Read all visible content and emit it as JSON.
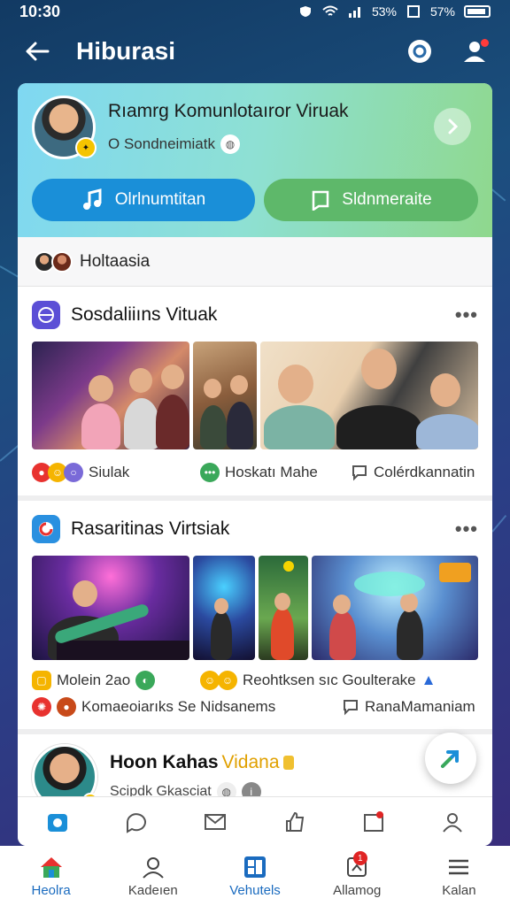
{
  "status_bar": {
    "time": "10:30",
    "battery_text_1": "5̈3%",
    "battery_text_2": "5̈7%"
  },
  "app_bar": {
    "title": "Hiburasi"
  },
  "header": {
    "name": "Rıamrg Komunlotaıror Viruak",
    "subtitle": "O Sondneimiatk",
    "button_left": "Olrlnumtitan",
    "button_right": "Sldnmeraite"
  },
  "section": {
    "label": "Holtaasia"
  },
  "post1": {
    "title": "Sosdaliiıns Vituak",
    "reaction_1": "Siulak",
    "reaction_2": "Hoskatı Mahe",
    "reaction_3": "Colérdkannatin"
  },
  "post2": {
    "title": "Rasaritinas Virtsiak",
    "reaction_1": "Molein 2ao",
    "reaction_2": "Reohtksen sıc Goulterake",
    "reaction_3": "Komaeoiarıks Se Nidsanems",
    "reaction_4": "RanaMamaniam"
  },
  "post3": {
    "name": "Hoon Kahas",
    "name_highlight": "Vidana",
    "subtitle": "Scipdk Gkasciat"
  },
  "bottom_nav": {
    "items": [
      {
        "label": "Heolra",
        "icon": "home-icon"
      },
      {
        "label": "Kadeıen",
        "icon": "profile-icon"
      },
      {
        "label": "Vehutels",
        "icon": "grid-icon"
      },
      {
        "label": "Allamog",
        "icon": "notification-icon"
      },
      {
        "label": "Kalan",
        "icon": "menu-icon"
      }
    ],
    "alert_badge": "1"
  },
  "colors": {
    "primary_blue": "#1a8fd8",
    "accent_green": "#5eb86a",
    "badge_red": "#e02424"
  }
}
